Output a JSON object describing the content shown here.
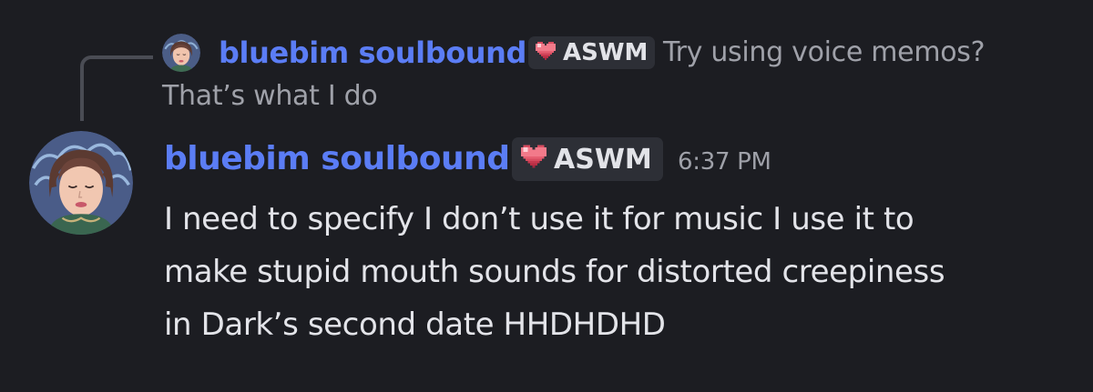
{
  "reply": {
    "author": "bluebim soulbound",
    "tag": "ASWM",
    "text_line_1": "Try using voice memos?",
    "text_line_2": "That’s what I do"
  },
  "message": {
    "author": "bluebim soulbound",
    "tag": "ASWM",
    "timestamp": "6:37 PM",
    "lines": [
      "I need to specify I don’t use it for music I use it to",
      "make stupid mouth sounds for distorted creepiness",
      "in Dark’s second date HHDHDHD"
    ]
  },
  "colors": {
    "background": "#1c1d22",
    "username": "#5b7df5",
    "tag_background": "#2d2f36",
    "muted_text": "#9fa1a9",
    "body_text": "#e3e4e9",
    "heart": "#f27a8a"
  },
  "icons": {
    "avatar": "avatar-illustration",
    "tag_icon": "pixel-heart-icon"
  }
}
